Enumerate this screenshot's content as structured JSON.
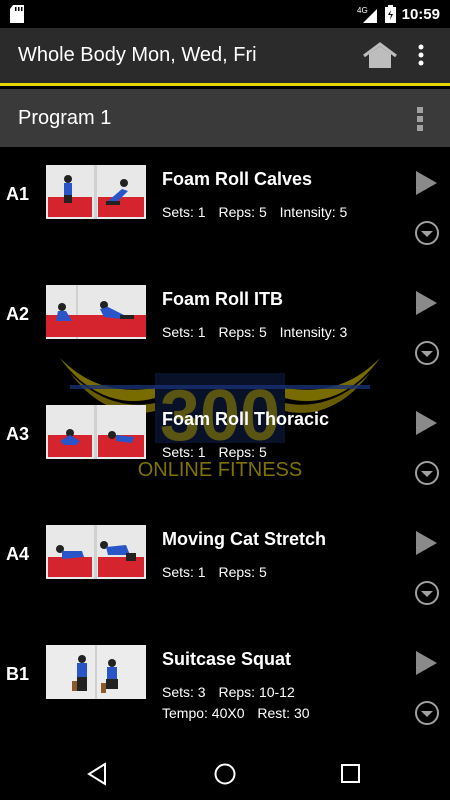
{
  "status_bar": {
    "time": "10:59",
    "network": "4G",
    "icons": [
      "sd-card-icon",
      "signal-icon",
      "battery-icon"
    ]
  },
  "app_bar": {
    "title": "Whole Body Mon, Wed, Fri",
    "accent_color": "#e6d600",
    "icons": [
      "home-icon",
      "overflow-menu-icon"
    ]
  },
  "program": {
    "title": "Program 1"
  },
  "watermark": {
    "brand_number": "300",
    "brand_text": "ONLINE FITNESS"
  },
  "exercises": [
    {
      "code": "A1",
      "name": "Foam Roll Calves",
      "sets": "Sets: 1",
      "reps": "Reps: 5",
      "extra": "Intensity: 5"
    },
    {
      "code": "A2",
      "name": "Foam Roll ITB",
      "sets": "Sets: 1",
      "reps": "Reps: 5",
      "extra": "Intensity: 3"
    },
    {
      "code": "A3",
      "name": "Foam Roll Thoracic",
      "sets": "Sets: 1",
      "reps": "Reps: 5"
    },
    {
      "code": "A4",
      "name": "Moving Cat Stretch",
      "sets": "Sets: 1",
      "reps": "Reps: 5"
    },
    {
      "code": "B1",
      "name": "Suitcase Squat",
      "sets": "Sets: 3",
      "reps": "Reps: 10-12",
      "tempo": "Tempo: 40X0",
      "rest": "Rest: 30"
    }
  ],
  "nav_bar": {
    "icons": [
      "back-icon",
      "home-icon",
      "recents-icon"
    ]
  }
}
